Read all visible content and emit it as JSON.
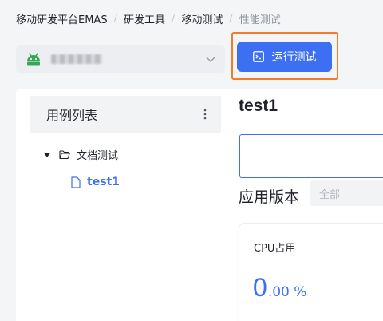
{
  "breadcrumb": [
    "移动研发平台EMAS",
    "研发工具",
    "移动测试",
    "性能测试"
  ],
  "breadcrumb_separator": "/",
  "app_selector": {
    "platform_icon": "android-icon",
    "chevron_icon": "chevron-down-icon"
  },
  "toolbar": {
    "run_label": "运行测试",
    "run_icon": "terminal-icon"
  },
  "test_list": {
    "title": "用例列表",
    "more_icon": "more-vertical-icon",
    "folder": {
      "label": "文档测试",
      "expanded": true
    },
    "items": [
      {
        "label": "test1",
        "selected": true
      }
    ]
  },
  "detail": {
    "title": "test1",
    "version_label": "应用版本",
    "version_placeholder": "全部"
  },
  "cpu_card": {
    "title": "CPU占用",
    "value_int": "0",
    "value_frac": ".00 %"
  },
  "colors": {
    "accent": "#3d6ff2",
    "highlight": "#f47a2c",
    "android": "#34a853"
  }
}
